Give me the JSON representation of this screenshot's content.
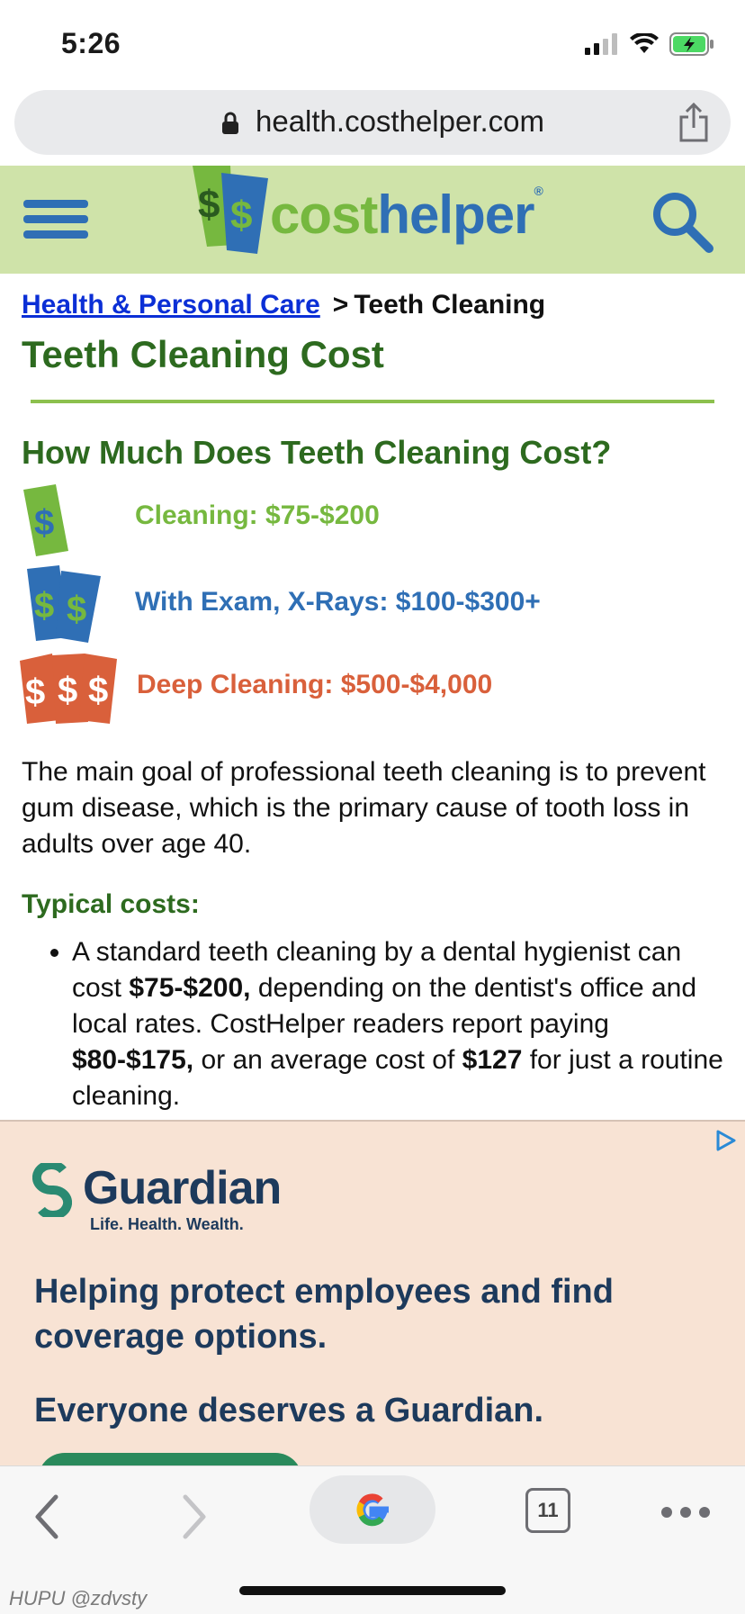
{
  "status_bar": {
    "time": "5:26"
  },
  "browser": {
    "domain": "health.costhelper.com",
    "tab_count": "11"
  },
  "site": {
    "logo_cost": "cost",
    "logo_helper": "helper",
    "logo_reg": "®"
  },
  "breadcrumb": {
    "parent": "Health & Personal Care",
    "separator": ">",
    "current": "Teeth Cleaning"
  },
  "page": {
    "title": "Teeth Cleaning Cost",
    "section_title": "How Much Does Teeth Cleaning Cost?",
    "prices": [
      {
        "label": "Cleaning: $75-$200",
        "color": "#76b83f",
        "icon": "dollar-one-icon"
      },
      {
        "label": "With Exam, X-Rays: $100-$300+",
        "color": "#2f6fb5",
        "icon": "dollar-two-icon"
      },
      {
        "label": "Deep Cleaning: $500-$4,000",
        "color": "#d9603b",
        "icon": "dollar-three-icon"
      }
    ],
    "intro": "The main goal of professional teeth cleaning is to prevent gum disease, which is the primary cause of tooth loss in adults over age 40.",
    "typical_heading": "Typical costs:",
    "bullet": {
      "part1": "A standard teeth cleaning by a dental hygienist can cost ",
      "bold1": "$75-$200,",
      "part2": " depending on the dentist's office and local rates. CostHelper readers report paying ",
      "bold2": "$80-$175,",
      "part3": " or an average cost of ",
      "bold3": "$127",
      "part4": " for just a routine cleaning."
    }
  },
  "ad": {
    "brand": "Guardian",
    "tagline": "Life. Health. Wealth.",
    "headline": "Helping protect employees and find coverage options.",
    "slogan": "Everyone deserves a Guardian."
  },
  "watermark": "HUPU @zdvsty",
  "colors": {
    "header_bg": "#cfe3a9",
    "title_green": "#2d6a1f",
    "link_blue": "#0b2fd6",
    "ad_bg": "#f8e3d4"
  }
}
